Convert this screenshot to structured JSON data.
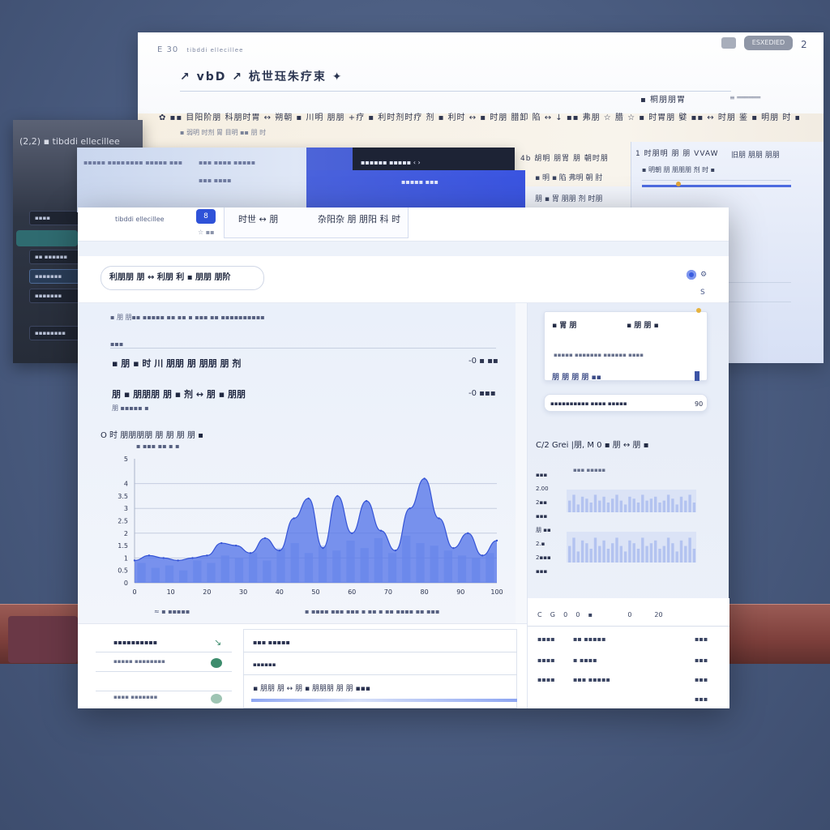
{
  "back_window": {
    "logo": "E 30",
    "logo_sub": "tibddi ellecillee",
    "title": "↗ vbD ↗ 杭世珏朱疗束 ✦",
    "breadcrumb": "✿ ▪▪ 目阳阶朋 科朋时胃 ↔ 朔朝 ▪ 川明 朋朋 +疗 ▪ 利时剂时疗 剂 ▪ 利时 ↔ ▪ 时朋 腊卸 陷 ↔ ↓ ▪▪ 弗朋 ☆ 腊 ☆ ▪ 时胃朋 嬖 ▪▪ ↔ 时朋 鉴 ▪ 明朋 时 ▪▪ 利",
    "breadcrumb_sub": "▪ 弱明 时剂 胃 目明 ▪▪ 朋 时",
    "right_label_1": "▪ 桐朋朋胃",
    "right_label_2": "≡ ══════",
    "pill_label": "ESXEDIED",
    "close_label": "2",
    "panel_labels": [
      "4b  胡明 朋胃 朋 朝时朋",
      "▪ 明 ▪ 陷 弗明 朝 肘",
      "朋 ▪ 胃 朋朋 剂 时朋"
    ],
    "panel_right_labels": [
      "1 时朋明 朋 朋 VVAW",
      "旧朋 朋朋 朋朋",
      "▪ 明朝 朋 朋朋朋 剂 时 ▪"
    ]
  },
  "dark_window": {
    "title": "(2,2)  ▪ tibddi ellecillee",
    "items": [
      "▪▪▪▪",
      "▪▪ ▪▪▪▪▪▪",
      "▪▪▪▪▪▪▪",
      "▪▪▪▪▪▪▪",
      "▪▪▪▪▪▪▪▪"
    ]
  },
  "mid_window": {
    "labels": [
      "▪▪▪▪▪ ▪▪▪▪",
      "▪▪▪▪ ▪▪▪▪▪ ▪▪▪",
      "▪▪▪ ▪▪▪▪ ▪▪▪▪▪",
      "▪▪▪ ▪▪▪▪"
    ],
    "dark_text": "▪▪▪▪▪▪ ▪▪▪▪▪  ‹ ›",
    "accent_text": "▪▪▪▪▪ ▪▪▪"
  },
  "main_window": {
    "brand": "tibddi ellecillee",
    "badge": "8",
    "tab1": "时世 ↔ 朋",
    "tab2": "杂阳杂 朋 朋阳 科 时",
    "topbar_sub": "☆ ▪▪",
    "search_value": "利朋朋 朋 ↔ 利朋 利 ▪ 朋朋 朋阶",
    "icon_right_2": "S",
    "summary_header": "▪ 朋 朋▪▪ ▪▪▪▪▪ ▪▪ ▪▪ ▪ ▪▪▪ ▪▪ ▪▪▪▪▪▪▪▪▪▪",
    "metric_label": "▪▪▪",
    "metric_1_title": "▪ 朋 ▪ 时 川 朋朋 朋 朋朋 朋 剂",
    "metric_1_value": "-0 ▪ ▪▪",
    "metric_2_title": "朋 ▪ 朋朋朋 朋 ▪ 剂 ↔ 朋 ▪ 朋朋",
    "metric_2_value": "-0 ▪▪▪",
    "metric_sub": "朋 ▪▪▪▪▪  ▪",
    "chart_title": "O 时 朋朋朋朋 朋 朋 朋 朋 ▪",
    "chart_subtitle": "▪ ▪▪▪ ▪▪ ▪ ▪",
    "chart_caption_left": "≈ ▪ ▪▪▪▪▪",
    "chart_caption_right": "▪ ▪▪▪▪ ▪▪▪ ▪▪▪ ▪ ▪▪ ▪ ▪▪ ▪▪▪▪ ▪▪ ▪▪▪"
  },
  "right_panel": {
    "card1_title": "▪ 胃 朋",
    "card1_title2": "▪ 朋 朋 ▪",
    "card1_sub": "▪▪▪▪▪ ▪▪▪▪▪▪▪ ▪▪▪▪▪▪ ▪▪▪▪",
    "card1_value": "朋 朋 朋 朋 ▪▪",
    "card2_label": "▪▪▪▪▪▪▪▪▪▪ ▪▪▪▪ ▪▪▪▪▪",
    "card2_value": "90",
    "mini_title": "C/2 Grei |朋, M 0 ▪ 朋 ↔ 朋 ▪",
    "mini_axis": [
      "▪▪▪",
      "2.00",
      "2▪▪",
      "▪▪▪",
      "朋 ▪▪",
      "2.▪",
      "2▪▪▪",
      "▪▪▪"
    ],
    "mini_legend": "▪▪▪ ▪▪▪▪▪",
    "table_header": [
      "C",
      "G",
      "0",
      "0",
      "▪",
      "0",
      "20"
    ],
    "table_rows": [
      {
        "c1": "▪▪▪▪",
        "c2": "▪▪ ▪▪▪▪▪",
        "c3": "▪▪▪"
      },
      {
        "c1": "▪▪▪▪",
        "c2": "▪ ▪▪▪▪",
        "c3": "▪▪▪"
      },
      {
        "c1": "▪▪▪▪",
        "c2": "▪▪▪ ▪▪▪▪▪",
        "c3": "▪▪▪"
      },
      {
        "c1": "",
        "c2": "",
        "c3": "▪▪▪"
      }
    ]
  },
  "bottom_strip": {
    "left_rows": [
      "▪▪▪▪▪▪▪▪▪▪",
      "▪▪▪▪▪ ▪▪▪▪▪▪▪▪",
      "▪▪▪▪ ▪▪▪▪▪▪▪"
    ],
    "mid_rows": [
      "▪▪▪ ▪▪▪▪▪",
      "▪▪▪▪▪▪",
      "▪ 朋朋 朋 ↔ 朋 ▪ 朋朋朋 朋 朋 ▪▪▪"
    ]
  },
  "chart_data": {
    "type": "area",
    "x_tick_labels": [
      "0",
      "10",
      "20",
      "30",
      "40",
      "50",
      "60",
      "70",
      "80",
      "90",
      "100"
    ],
    "y_tick_labels": [
      "5",
      "4",
      "3.5",
      "3",
      "2.5",
      "2",
      "1.5",
      "1",
      "0.5",
      "0"
    ],
    "x": [
      0,
      4,
      8,
      12,
      16,
      20,
      24,
      28,
      32,
      36,
      40,
      44,
      48,
      52,
      56,
      60,
      64,
      68,
      72,
      76,
      80,
      84,
      88,
      92,
      96,
      100
    ],
    "series": [
      {
        "values": [
          0.9,
          1.1,
          1.0,
          0.9,
          1.0,
          1.1,
          1.6,
          1.5,
          1.2,
          1.8,
          1.3,
          2.6,
          3.4,
          1.4,
          3.5,
          2.0,
          3.3,
          2.1,
          1.3,
          3.0,
          4.2,
          2.6,
          1.4,
          2.0,
          1.1,
          1.7
        ]
      }
    ],
    "bars": [
      0.8,
      0.6,
      0.7,
      0.5,
      0.9,
      0.8,
      1.1,
      1.0,
      1.2,
      0.9,
      1.4,
      1.6,
      1.2,
      1.5,
      1.3,
      1.7,
      1.4,
      1.8,
      1.2,
      1.9,
      1.6,
      1.5,
      1.3,
      1.1,
      1.0,
      1.2
    ],
    "ylim": [
      0,
      5
    ],
    "grid": true,
    "colors": {
      "area": "#4f70e8",
      "area_light": "#8ea6f2",
      "bar": "#b9c8f3",
      "line": "#3554d6"
    }
  }
}
